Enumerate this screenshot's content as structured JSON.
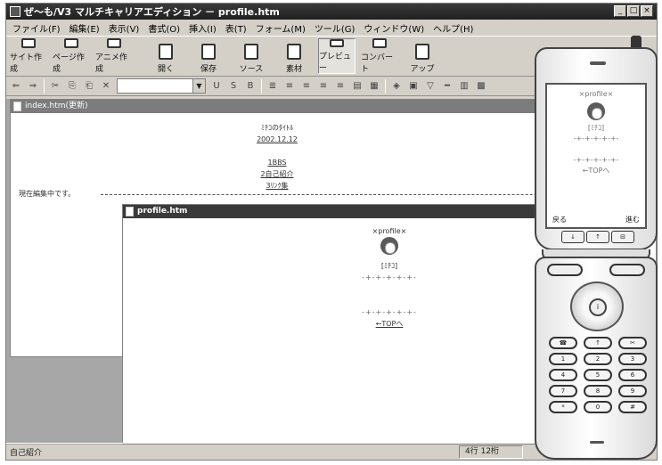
{
  "window": {
    "title": "ぜ〜も/V3 マルチキャリアエディション － profile.htm"
  },
  "window_buttons": [
    "_",
    "□",
    "×"
  ],
  "menu": [
    "ファイル(F)",
    "編集(E)",
    "表示(V)",
    "書式(O)",
    "挿入(I)",
    "表(T)",
    "フォーム(M)",
    "ツール(G)",
    "ウィンドウ(W)",
    "ヘルプ(H)"
  ],
  "toolbar": [
    {
      "label": "サイト作成",
      "icon": "site-create-icon"
    },
    {
      "label": "ページ作成",
      "icon": "page-create-icon"
    },
    {
      "label": "アニメ作成",
      "icon": "anime-create-icon"
    },
    {
      "label": "開く",
      "icon": "folder-open-icon"
    },
    {
      "label": "保存",
      "icon": "save-icon"
    },
    {
      "label": "ソース",
      "icon": "source-icon"
    },
    {
      "label": "素材",
      "icon": "material-icon"
    },
    {
      "label": "プレビュー",
      "icon": "preview-phone-icon"
    },
    {
      "label": "コンバート",
      "icon": "convert-icon"
    },
    {
      "label": "アップ",
      "icon": "upload-icon"
    }
  ],
  "format_bar": {
    "buttons_left": [
      "⇐",
      "⇒",
      "✂",
      "⎘",
      "⎗",
      "✕"
    ],
    "buttons_right": [
      "U",
      "S",
      "B",
      "≣",
      "≡",
      "≡",
      "≡",
      "≡",
      "▤",
      "▦",
      "◈",
      "▣",
      "▽",
      "━",
      "▥",
      "▩"
    ]
  },
  "doc_index": {
    "title": "index.htm(更新)",
    "lines": [
      "ﾐﾁｺのﾀｲﾄﾙ",
      "2002.12.12",
      "",
      "1BBS",
      "2自己紹介",
      "3ﾘﾝｸ集"
    ]
  },
  "doc_profile": {
    "title": "profile.htm",
    "header": "×profile×",
    "name": "[ﾐﾁｺ]",
    "rule": "-+-+-+-+-+-",
    "link": "←TOPへ",
    "marquee": "現在編集中です。"
  },
  "status": {
    "left": "自己紹介",
    "position": "4行 12桁"
  },
  "phone": {
    "screen_header": "×profile×",
    "screen_name": "[ﾐﾁｺ]",
    "screen_rule": "-+-+-+-+-+-",
    "screen_link": "←TOPへ",
    "softkey_left": "戻る",
    "softkey_right": "進む",
    "under_screen": [
      "↓",
      "↑",
      "⊟"
    ],
    "keys": [
      [
        "☎",
        "↑",
        "✂"
      ],
      [
        "1",
        "2",
        "3"
      ],
      [
        "4",
        "5",
        "6"
      ],
      [
        "7",
        "8",
        "9"
      ],
      [
        "*",
        "0",
        "#"
      ]
    ],
    "dpad_center": "i"
  }
}
